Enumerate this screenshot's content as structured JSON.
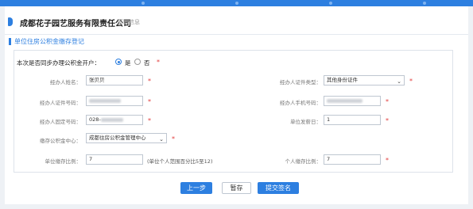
{
  "colors": {
    "accent": "#2d7fe0",
    "required": "#e23b3b"
  },
  "header": {
    "company": "成都花子园艺服务有限责任公司",
    "crumb": "基本信息"
  },
  "section": {
    "title": "单位住房公积金缴存登记"
  },
  "question": {
    "label": "本次是否同步办理公积金开户：",
    "options": [
      "是",
      "否"
    ],
    "selected": "是"
  },
  "form": {
    "agent_name": {
      "label": "经办人姓名：",
      "value": "张贝贝"
    },
    "agent_id_type": {
      "label": "经办人证件类型：",
      "value": "其他身份证件"
    },
    "agent_id_no": {
      "label": "经办人证件号码："
    },
    "agent_phone": {
      "label": "经办人手机号码："
    },
    "agent_landline": {
      "label": "经办人固定号码：",
      "value": "028-"
    },
    "payday": {
      "label": "单位发薪日：",
      "value": "1"
    },
    "center": {
      "label": "缴存公积金中心：",
      "value": "成都住房公积金管理中心"
    },
    "unit_ratio": {
      "label": "单位缴存比例：",
      "value": "7",
      "note": "(单位个人范围百分比5至12)"
    },
    "personal_ratio": {
      "label": "个人缴存比例：",
      "value": "7"
    }
  },
  "buttons": {
    "prev": "上一步",
    "save": "暂存",
    "submit": "提交签名"
  }
}
